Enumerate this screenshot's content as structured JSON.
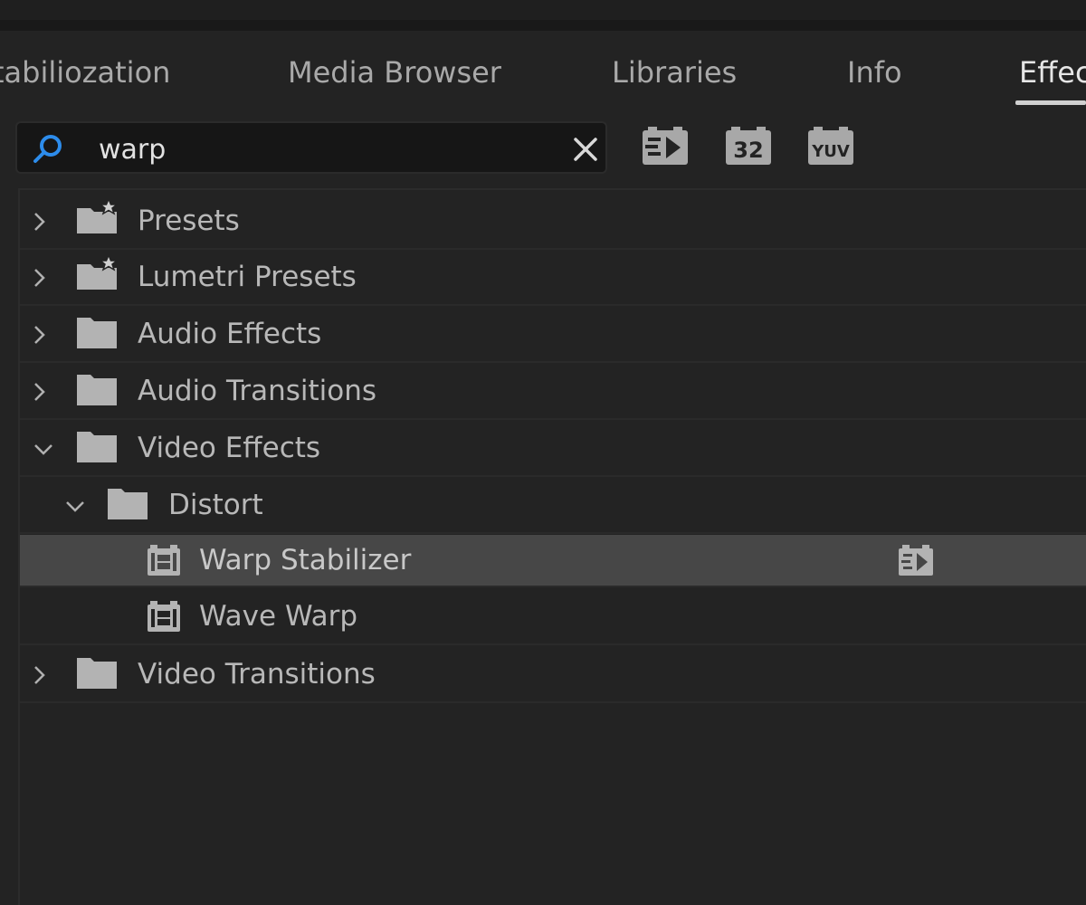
{
  "tabs": [
    {
      "label": "tabiliozation"
    },
    {
      "label": "Media Browser"
    },
    {
      "label": "Libraries"
    },
    {
      "label": "Info"
    },
    {
      "label": "Effec"
    }
  ],
  "search": {
    "value": "warp",
    "placeholder": ""
  },
  "filters": [
    {
      "name": "accelerated-effects",
      "icon": "accelerated-effects-icon"
    },
    {
      "name": "32-bit-color",
      "icon": "32-bit-icon",
      "label": "32"
    },
    {
      "name": "yuv",
      "icon": "yuv-icon",
      "label": "YUV"
    }
  ],
  "tree": {
    "presets": "Presets",
    "lumetri_presets": "Lumetri Presets",
    "audio_effects": "Audio Effects",
    "audio_transitions": "Audio Transitions",
    "video_effects": "Video Effects",
    "distort": "Distort",
    "warp_stabilizer": "Warp Stabilizer",
    "wave_warp": "Wave Warp",
    "video_transitions": "Video Transitions"
  },
  "colors": {
    "background": "#232323",
    "selected_row": "#474747",
    "search_accent": "#2d8ceb"
  }
}
